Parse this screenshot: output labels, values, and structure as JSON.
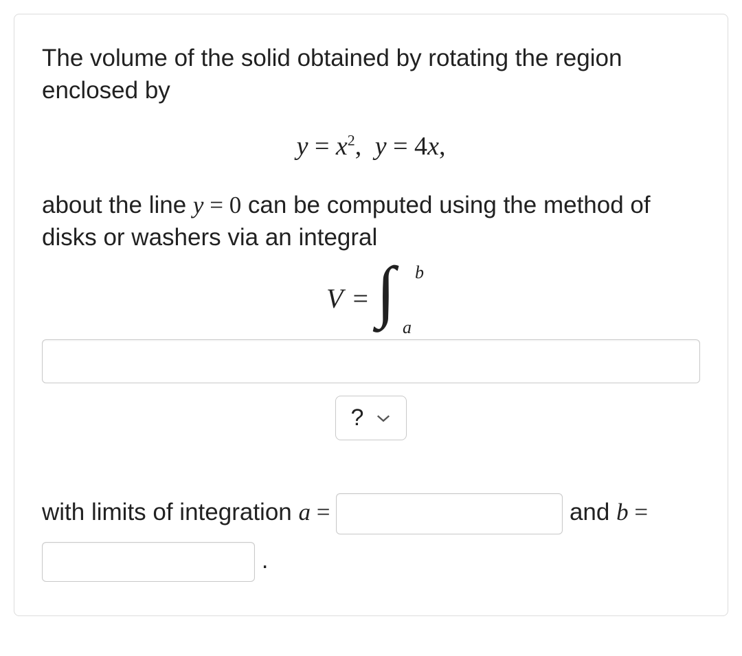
{
  "card": {
    "intro_part1": "The volume of the solid obtained by rotating the region enclosed by",
    "equations_display": {
      "y_var": "y",
      "eq": " = ",
      "x_var": "x",
      "squared": "2",
      "comma": ", ",
      "y_var2": "y",
      "eq2": " = 4",
      "x_var2": "x",
      "trailing_comma": ","
    },
    "intro_part2_pre": "about the line ",
    "intro_part2_math_y": "y",
    "intro_part2_math_eq": " = 0",
    "intro_part2_post": " can be computed using the method of disks or washers via an integral",
    "integral": {
      "V": "V",
      "eq": " = ",
      "upper": "b",
      "lower": "a"
    },
    "integrand_input_value": "",
    "var_select_label": "?",
    "limits_text_pre": "with limits of integration ",
    "limits_a_var": "a",
    "limits_a_eq": " = ",
    "a_value": "",
    "limits_and": " and ",
    "limits_b_var": "b",
    "limits_b_eq": " = ",
    "b_value": "",
    "period": "."
  }
}
